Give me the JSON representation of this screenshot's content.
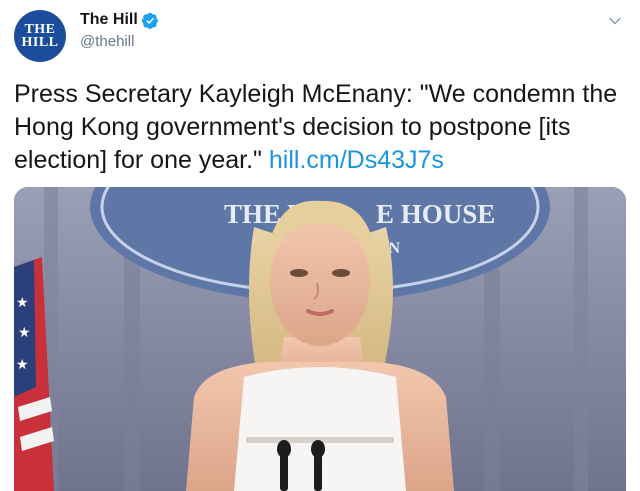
{
  "account": {
    "avatar_text": [
      "THE",
      "HILL"
    ],
    "display_name": "The Hill",
    "handle": "@thehill",
    "verified": true
  },
  "icons": {
    "verified": "verified-badge-icon",
    "menu": "chevron-down-icon"
  },
  "tweet": {
    "text": "Press Secretary Kayleigh McEnany: \"We condemn the Hong Kong government's decision to postpone [its election] for one year.\"",
    "link": "hill.cm/Ds43J7s"
  },
  "media": {
    "sign_text_main": "THE WHITE HOUSE",
    "sign_text_sub": "ON"
  },
  "colors": {
    "link": "#1b95e0",
    "avatar_bg": "#1a4d9c",
    "verified": "#1da1f2",
    "handle": "#657786"
  }
}
